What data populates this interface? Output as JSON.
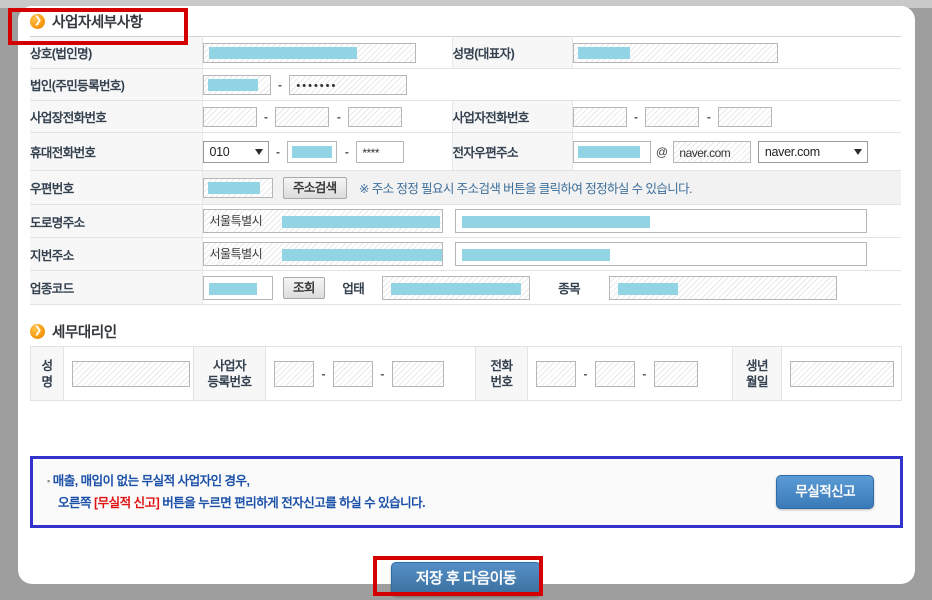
{
  "sections": {
    "business_detail": {
      "title": "사업자세부사항",
      "icon": "arrow-circle-icon"
    },
    "tax_agent": {
      "title": "세무대리인",
      "icon": "arrow-circle-icon"
    }
  },
  "form": {
    "rows": {
      "company_name": {
        "label": "상호(법인명)",
        "right_label": "성명(대표자)"
      },
      "corp_reg_no": {
        "label": "법인(주민등록번호)",
        "masked_value": "•••••••"
      },
      "place_phone": {
        "label": "사업장전화번호",
        "right_label": "사업자전화번호"
      },
      "mobile_phone": {
        "label": "휴대전화번호",
        "prefix_selected": "010",
        "last_value": "****",
        "right_label": "전자우편주소",
        "email_domain_text": "naver.com",
        "email_domain_selected": "naver.com",
        "at": "@"
      },
      "postal": {
        "label": "우편번호",
        "search_button": "주소검색",
        "note": "※ 주소 정정 필요시 주소검색 버튼을 클릭하여 정정하실 수 있습니다."
      },
      "road_address": {
        "label": "도로명주소",
        "city": "서울특별시"
      },
      "lot_address": {
        "label": "지번주소",
        "city": "서울특별시"
      },
      "industry_code": {
        "label": "업종코드",
        "lookup_button": "조회",
        "mid_label": "업태",
        "end_label": "종목"
      }
    }
  },
  "agent_table": {
    "name_label": "성\n명",
    "name_label_l1": "성",
    "name_label_l2": "명",
    "biz_no_label_l1": "사업자",
    "biz_no_label_l2": "등록번호",
    "phone_label_l1": "전화",
    "phone_label_l2": "번호",
    "birth_label_l1": "생년",
    "birth_label_l2": "월일"
  },
  "notice": {
    "line1": "매출, 매입이 없는 무실적 사업자인 경우,",
    "line2_pre": "오른쪽 ",
    "line2_highlight": "[무실적 신고]",
    "line2_post": " 버튼을 누르면 편리하게 전자신고를 하실 수 있습니다.",
    "button_label": "무실적신고"
  },
  "footer": {
    "save_button": "저장 후 다음이동"
  },
  "colors": {
    "accent_orange": "#f79a10",
    "notice_border_blue": "#3333cc",
    "notice_text_blue": "#1b50a8",
    "highlight_red": "#e01414",
    "annotation_red": "#d40000",
    "button_blue": "#3a7ab8",
    "redaction_cyan": "#92d3e4"
  }
}
